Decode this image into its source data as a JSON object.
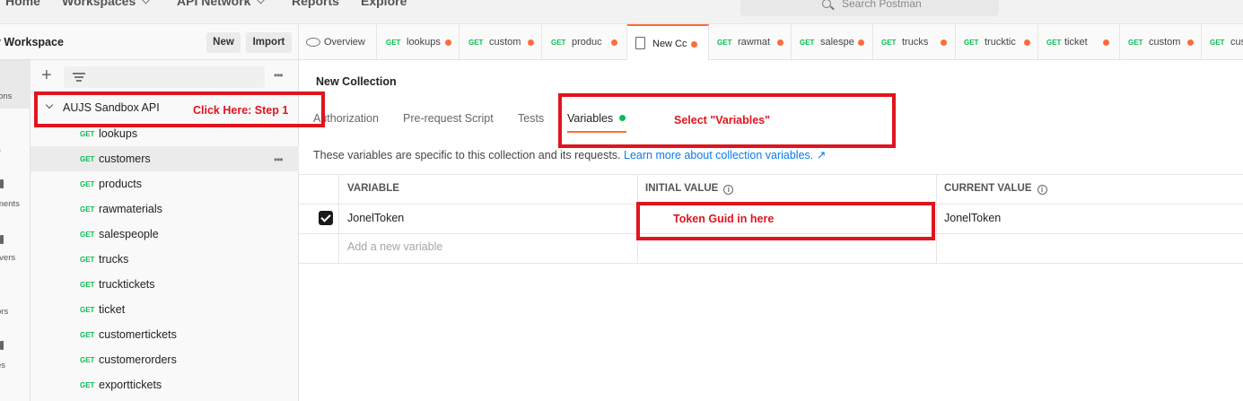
{
  "nav": {
    "items": [
      "Home",
      "Workspaces",
      "API Network",
      "Reports",
      "Explore"
    ],
    "search_placeholder": "Search Postman"
  },
  "sidebar": {
    "workspace_title": "y Workspace",
    "new_label": "New",
    "import_label": "Import",
    "rail_labels": [
      "ions",
      "s",
      "ments",
      "rvers",
      "ors",
      "es"
    ],
    "collection_name": "AUJS Sandbox API",
    "requests": [
      {
        "method": "GET",
        "name": "lookups"
      },
      {
        "method": "GET",
        "name": "customers"
      },
      {
        "method": "GET",
        "name": "products"
      },
      {
        "method": "GET",
        "name": "rawmaterials"
      },
      {
        "method": "GET",
        "name": "salespeople"
      },
      {
        "method": "GET",
        "name": "trucks"
      },
      {
        "method": "GET",
        "name": "trucktickets"
      },
      {
        "method": "GET",
        "name": "ticket"
      },
      {
        "method": "GET",
        "name": "customertickets"
      },
      {
        "method": "GET",
        "name": "customerorders"
      },
      {
        "method": "GET",
        "name": "exporttickets"
      }
    ]
  },
  "tabs": {
    "overview": "Overview",
    "items": [
      {
        "method": "GET",
        "name": "lookups"
      },
      {
        "method": "GET",
        "name": "custom"
      },
      {
        "method": "GET",
        "name": "produc"
      },
      {
        "method": "",
        "name": "New Cc"
      },
      {
        "method": "GET",
        "name": "rawmat"
      },
      {
        "method": "GET",
        "name": "salespe"
      },
      {
        "method": "GET",
        "name": "trucks"
      },
      {
        "method": "GET",
        "name": "trucktic"
      },
      {
        "method": "GET",
        "name": "ticket"
      },
      {
        "method": "GET",
        "name": "custom"
      },
      {
        "method": "GET",
        "name": "cus"
      }
    ]
  },
  "main": {
    "collection_title": "New Collection",
    "subtabs": [
      "Authorization",
      "Pre-request Script",
      "Tests",
      "Variables"
    ],
    "description": "These variables are specific to this collection and its requests.",
    "learn_more": "Learn more about collection variables. ↗",
    "table": {
      "headers": [
        "VARIABLE",
        "INITIAL VALUE",
        "CURRENT VALUE"
      ],
      "row": {
        "variable": "JonelToken",
        "initial": "",
        "current": "JonelToken"
      },
      "add_placeholder": "Add a new variable"
    }
  },
  "annotations": {
    "step1": "Click Here: Step 1",
    "select_variables": "Select \"Variables\"",
    "token_guid": "Token Guid in here"
  },
  "colors": {
    "accent": "#ff6c37",
    "get_method": "#0cbb52",
    "annotation_red": "#e0141e",
    "link": "#097bed"
  }
}
